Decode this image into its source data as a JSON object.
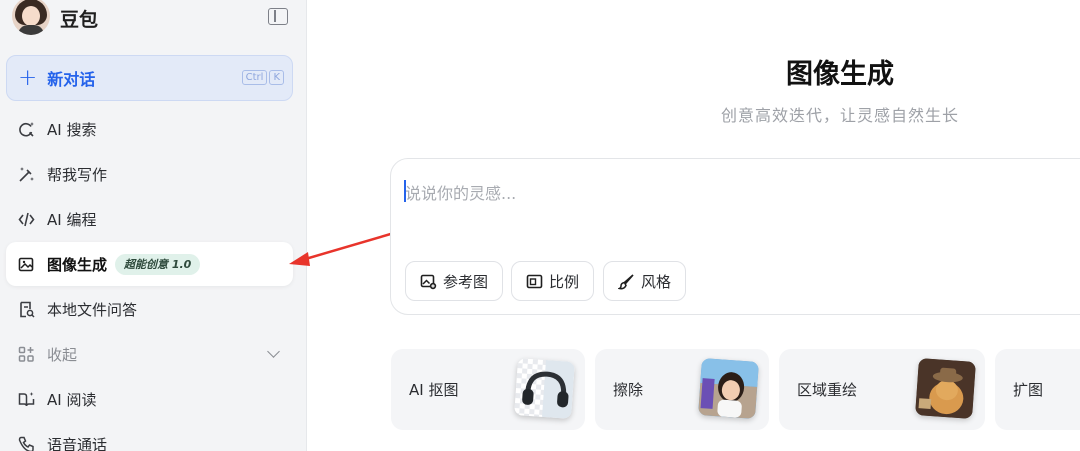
{
  "app": {
    "name": "豆包"
  },
  "sidebar": {
    "new_chat": {
      "label": "新对话",
      "shortcut": [
        "Ctrl",
        "K"
      ]
    },
    "items": [
      {
        "label": "AI 搜索",
        "icon": "ai-search-icon"
      },
      {
        "label": "帮我写作",
        "icon": "pen-sparkle-icon"
      },
      {
        "label": "AI 编程",
        "icon": "code-icon"
      },
      {
        "label": "图像生成",
        "icon": "image-gen-icon",
        "active": true,
        "badge": "超能创意 1.0"
      },
      {
        "label": "本地文件问答",
        "icon": "file-qa-icon"
      },
      {
        "label": "收起",
        "icon": "collapse-grid-icon"
      },
      {
        "label": "AI 阅读",
        "icon": "book-read-icon"
      },
      {
        "label": "语音通话",
        "icon": "phone-icon"
      }
    ]
  },
  "main": {
    "title": "图像生成",
    "subtitle": "创意高效迭代，让灵感自然生长",
    "prompt": {
      "placeholder": "说说你的灵感..."
    },
    "chips": [
      {
        "label": "参考图",
        "icon": "reference-image-icon"
      },
      {
        "label": "比例",
        "icon": "aspect-ratio-icon"
      },
      {
        "label": "风格",
        "icon": "brush-icon"
      }
    ],
    "tools": [
      {
        "label": "AI 抠图"
      },
      {
        "label": "擦除"
      },
      {
        "label": "区域重绘"
      },
      {
        "label": "扩图"
      }
    ]
  },
  "colors": {
    "accent": "#2563eb",
    "annotation_arrow": "#e8342b",
    "badge_bg": "#e0f1ea"
  }
}
